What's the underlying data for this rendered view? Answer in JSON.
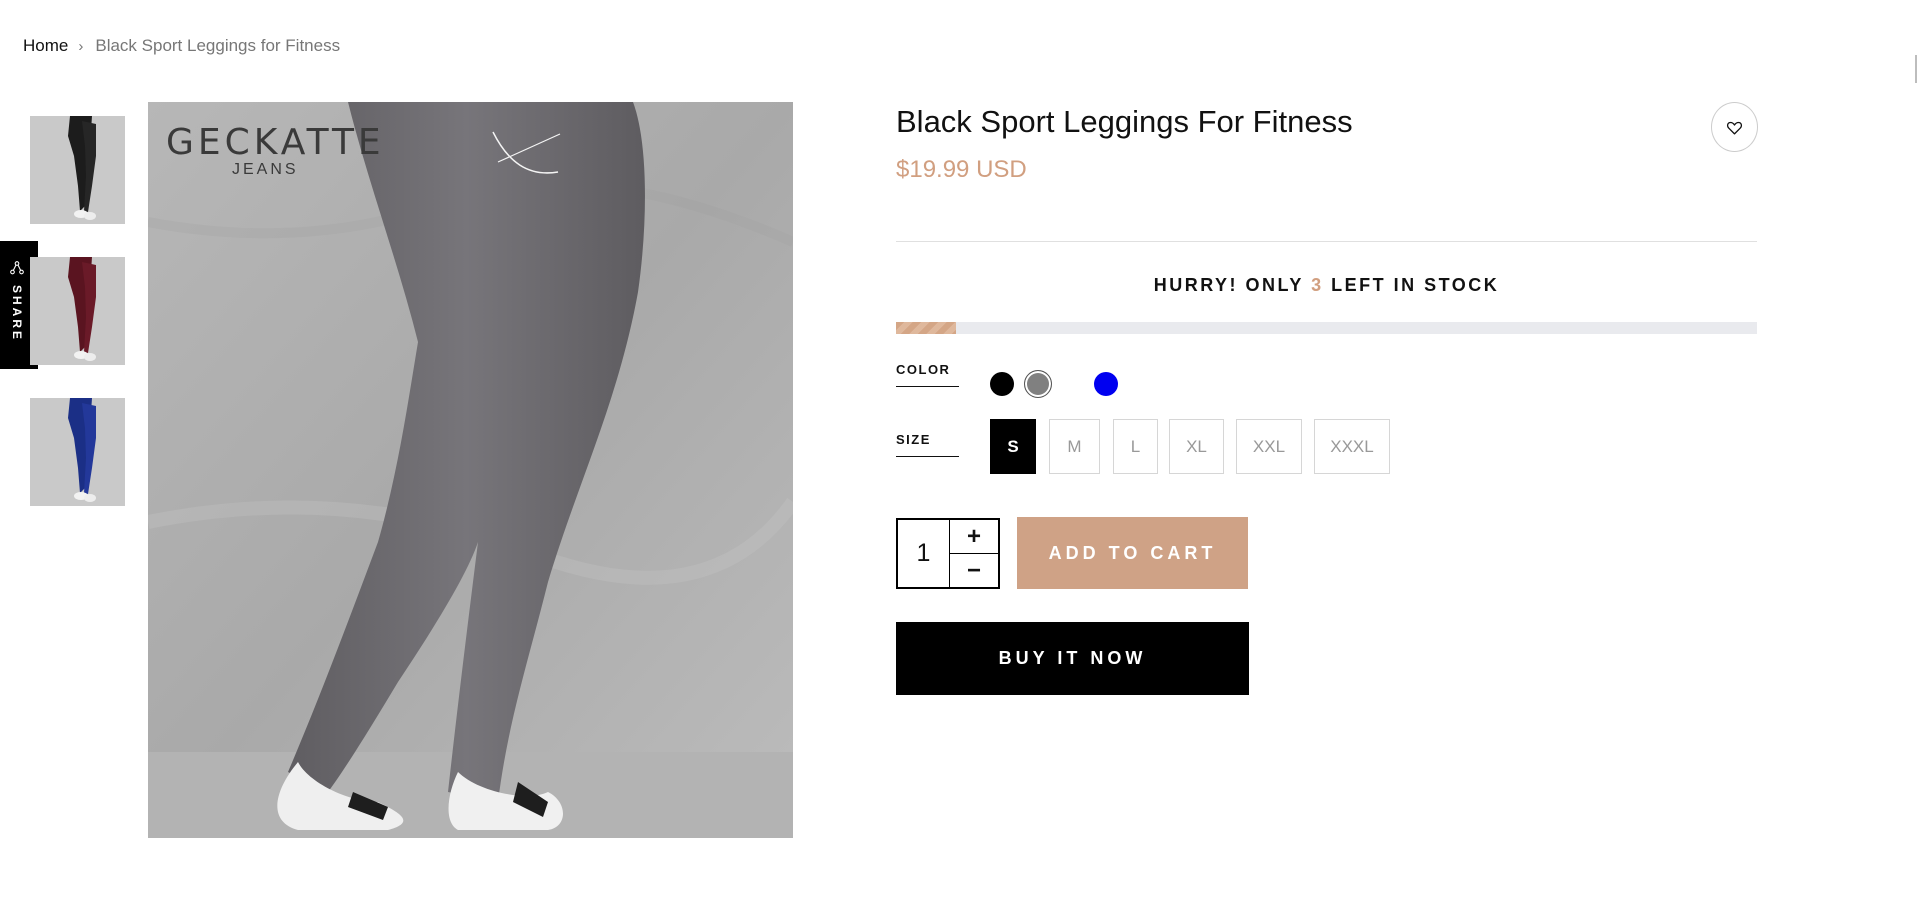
{
  "breadcrumb": {
    "home": "Home",
    "separator": "›",
    "current": "Black Sport Leggings for Fitness"
  },
  "share": {
    "label": "SHARE",
    "icon": "share-icon"
  },
  "gallery": {
    "thumbnails": [
      {
        "color": "black",
        "hex": "#1c1c1c"
      },
      {
        "color": "burgundy",
        "hex": "#5a1420"
      },
      {
        "color": "blue",
        "hex": "#1b2f86"
      }
    ],
    "main_image_color": "#6e6c70",
    "brand_name": "GECKATTE",
    "brand_sub": "JEANS"
  },
  "product": {
    "title": "Black Sport Leggings For Fitness",
    "price": "$19.99 USD",
    "wishlist_icon": "heart-icon"
  },
  "stock": {
    "prefix": "HURRY! ONLY",
    "count": "3",
    "suffix": "LEFT IN STOCK",
    "level_percent": 7
  },
  "options": {
    "color_label": "COLOR",
    "colors": [
      {
        "name": "black",
        "hex": "#000000"
      },
      {
        "name": "gray",
        "hex": "#808080",
        "selected": true
      },
      {
        "name": "blue",
        "hex": "#0000f0"
      }
    ],
    "size_label": "SIZE",
    "sizes": [
      "S",
      "M",
      "L",
      "XL",
      "XXL",
      "XXXL"
    ],
    "selected_size": "S"
  },
  "purchase": {
    "quantity": "1",
    "plus": "+",
    "minus": "−",
    "add_to_cart": "ADD TO CART",
    "buy_now": "BUY IT NOW"
  },
  "colors": {
    "accent": "#d19f80",
    "button_accent": "#cfa286",
    "stock_bar_track": "#e9eaee"
  }
}
